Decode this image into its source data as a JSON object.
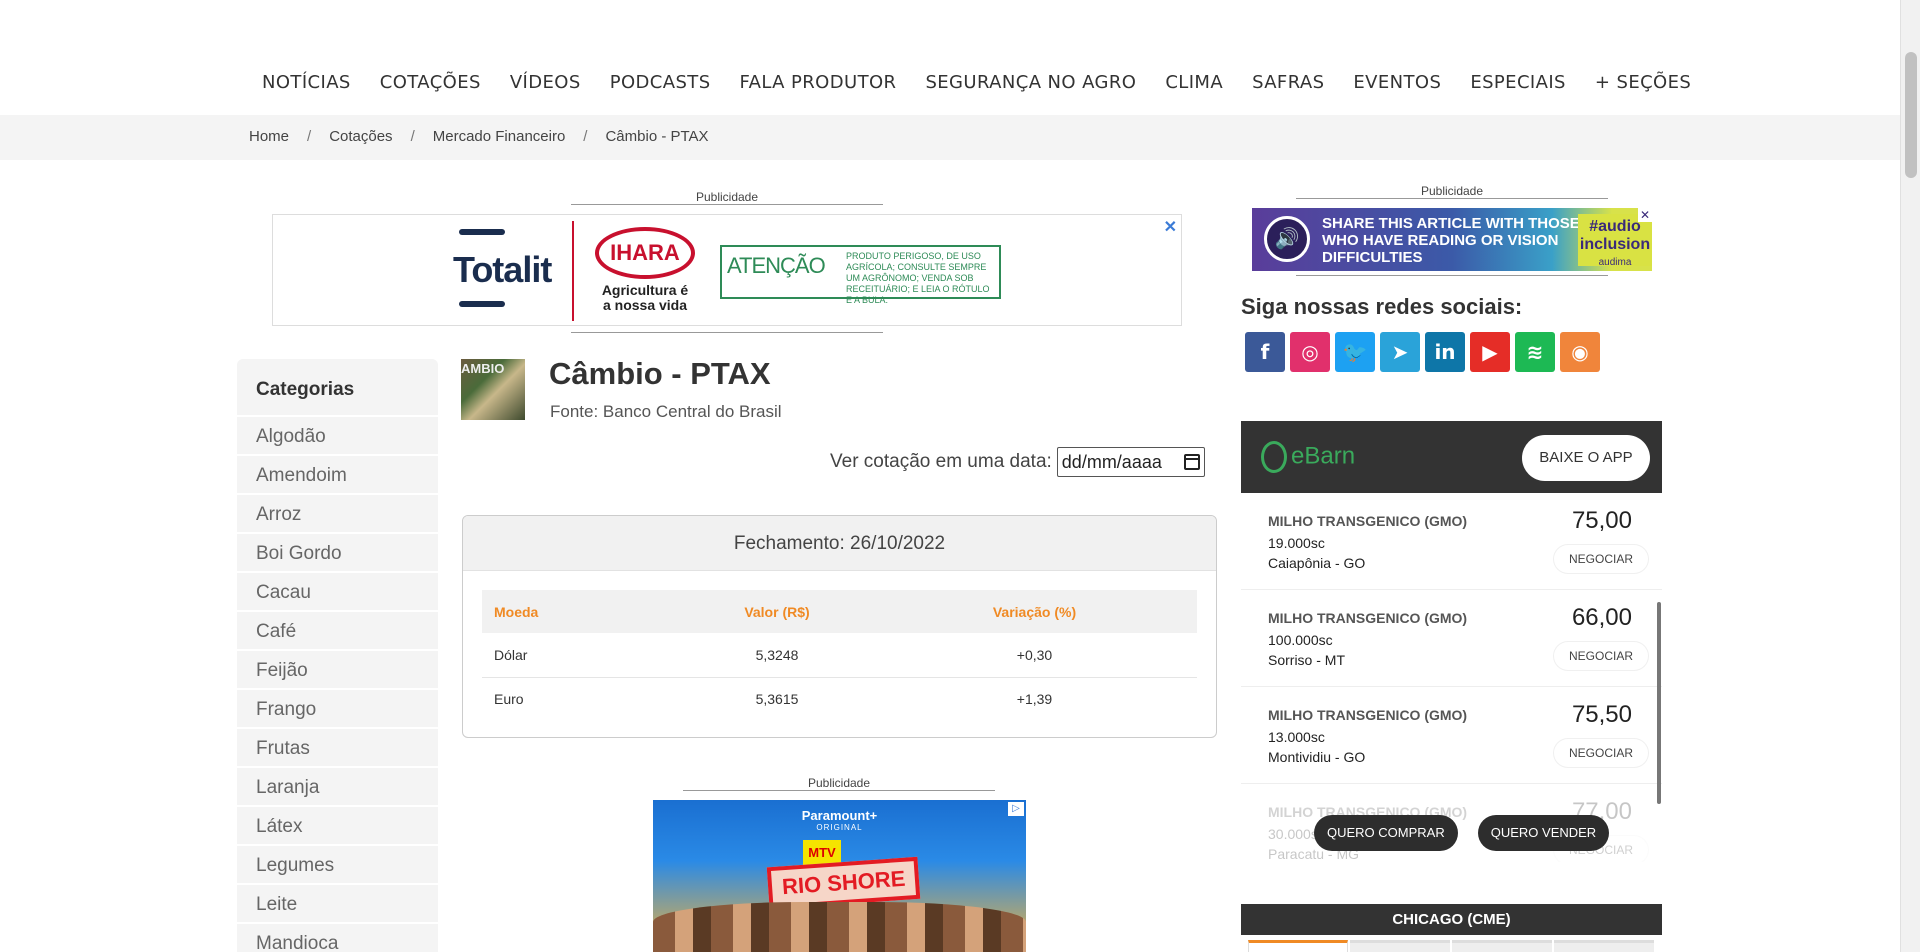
{
  "nav": {
    "items": [
      "NOTÍCIAS",
      "COTAÇÕES",
      "VÍDEOS",
      "PODCASTS",
      "FALA PRODUTOR",
      "SEGURANÇA NO AGRO",
      "CLIMA",
      "SAFRAS",
      "EVENTOS",
      "ESPECIAIS",
      "+ SEÇÕES"
    ]
  },
  "breadcrumb": {
    "items": [
      "Home",
      "Cotações",
      "Mercado Financeiro",
      "Câmbio - PTAX"
    ],
    "separator": "/"
  },
  "ads": {
    "label": "Publicidade",
    "top": {
      "brand1": "Totalit",
      "brand2": "IHARA",
      "brand2_tagline": "Agricultura é a nossa vida",
      "warning_title": "ATENÇÃO",
      "warning_text": "PRODUTO PERIGOSO, DE USO AGRÍCOLA; CONSULTE SEMPRE UM AGRÔNOMO; VENDA SOB RECEITUÁRIO; E LEIA O RÓTULO E A BULA.",
      "close": "✕"
    },
    "bottom": {
      "brand": "Paramount+",
      "brand_sub": "ORIGINAL",
      "network": "MTV",
      "show": "RIO SHORE"
    },
    "audio": {
      "text": "SHARE THIS ARTICLE WITH THOSE WHO HAVE READING OR VISION DIFFICULTIES",
      "tag": "#audio inclusion",
      "tag_brand": "audima",
      "close": "✕"
    }
  },
  "categories": {
    "title": "Categorias",
    "items": [
      "Algodão",
      "Amendoim",
      "Arroz",
      "Boi Gordo",
      "Cacau",
      "Café",
      "Feijão",
      "Frango",
      "Frutas",
      "Laranja",
      "Látex",
      "Legumes",
      "Leite",
      "Mandioca"
    ]
  },
  "header": {
    "thumb_text": "AMBIO",
    "title": "Câmbio - PTAX",
    "source": "Fonte: Banco Central do Brasil",
    "date_label": "Ver cotação em uma data:",
    "date_placeholder": "dd/mm/aaaa"
  },
  "quote_table": {
    "heading": "Fechamento: 26/10/2022",
    "columns": [
      "Moeda",
      "Valor (R$)",
      "Variação (%)"
    ],
    "rows": [
      [
        "Dólar",
        "5,3248",
        "+0,30"
      ],
      [
        "Euro",
        "5,3615",
        "+1,39"
      ]
    ]
  },
  "social": {
    "title": "Siga nossas redes sociais:",
    "networks": [
      {
        "name": "facebook-icon",
        "glyph": "f",
        "color": "#3b5998"
      },
      {
        "name": "instagram-icon",
        "glyph": "◎",
        "color": "#e1306c"
      },
      {
        "name": "twitter-icon",
        "glyph": "🐦",
        "color": "#1da1f2"
      },
      {
        "name": "telegram-icon",
        "glyph": "➤",
        "color": "#2aa3d9"
      },
      {
        "name": "linkedin-icon",
        "glyph": "in",
        "color": "#0e76a8"
      },
      {
        "name": "youtube-icon",
        "glyph": "▶",
        "color": "#e52d27"
      },
      {
        "name": "spotify-icon",
        "glyph": "≋",
        "color": "#1db954"
      },
      {
        "name": "rss-icon",
        "glyph": "◉",
        "color": "#f0853b"
      }
    ]
  },
  "ebarn": {
    "logo": "eBarn",
    "app_button": "BAIXE O APP",
    "negotiate_label": "NEGOCIAR",
    "items": [
      {
        "product": "MILHO TRANSGENICO (GMO)",
        "qty": "19.000sc",
        "location": "Caiapônia - GO",
        "price": "75,00"
      },
      {
        "product": "MILHO TRANSGENICO (GMO)",
        "qty": "100.000sc",
        "location": "Sorriso - MT",
        "price": "66,00"
      },
      {
        "product": "MILHO TRANSGENICO (GMO)",
        "qty": "13.000sc",
        "location": "Montividiu - GO",
        "price": "75,50"
      },
      {
        "product": "MILHO TRANSGENICO (GMO)",
        "qty": "30.000sc",
        "location": "Paracatu - MG",
        "price": "77,00"
      }
    ],
    "buy_button": "QUERO COMPRAR",
    "sell_button": "QUERO VENDER"
  },
  "chicago": {
    "title": "CHICAGO (CME)"
  }
}
